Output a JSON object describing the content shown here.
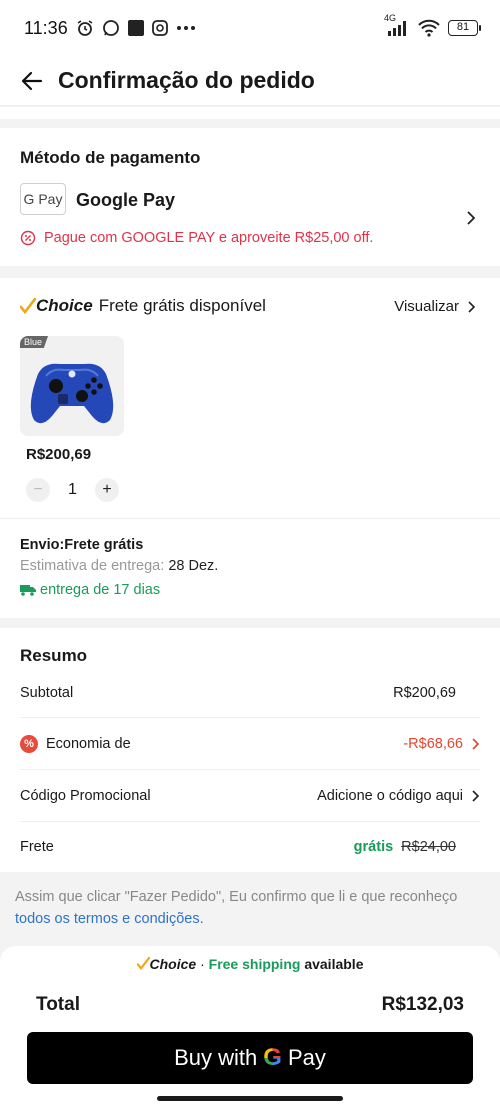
{
  "status_bar": {
    "time": "11:36",
    "network": "4G",
    "battery": "81"
  },
  "header": {
    "title": "Confirmação do pedido"
  },
  "payment": {
    "section_title": "Método de pagamento",
    "method_icon_text": "G Pay",
    "method_name": "Google Pay",
    "promo_text": "Pague com GOOGLE PAY e aproveite R$25,00 off."
  },
  "order": {
    "choice_brand": "Choice",
    "free_shipping_text": "Frete grátis disponível",
    "view_label": "Visualizar",
    "variant_tag": "Blue",
    "price": "R$200,69",
    "quantity": "1",
    "shipping_title": "Envio:Frete grátis",
    "eta_label": "Estimativa de entrega:",
    "eta_date": "28 Dez.",
    "delivery_text": "entrega de 17 dias"
  },
  "summary": {
    "title": "Resumo",
    "subtotal_label": "Subtotal",
    "subtotal_value": "R$200,69",
    "savings_label": "Economia de",
    "savings_value": "-R$68,66",
    "promo_code_label": "Código Promocional",
    "promo_code_value": "Adicione o código aqui",
    "shipping_label": "Frete",
    "shipping_free": "grátis",
    "shipping_old": "R$24,00"
  },
  "terms": {
    "text": "Assim que clicar \"Fazer Pedido\", Eu confirmo que li e que reconheço ",
    "link": "todos os termos e condições",
    "end": "."
  },
  "footer": {
    "choice_brand": "Choice",
    "separator": " · ",
    "free_shipping": "Free shipping",
    "available": " available",
    "total_label": "Total",
    "total_value": "R$132,03",
    "buy_prefix": "Buy with",
    "buy_g": "G",
    "buy_suffix": "Pay"
  },
  "colors": {
    "promo_red": "#e0334a",
    "green": "#1a9b5a",
    "link_blue": "#2f73c8",
    "choice_check": "#f2a516"
  }
}
